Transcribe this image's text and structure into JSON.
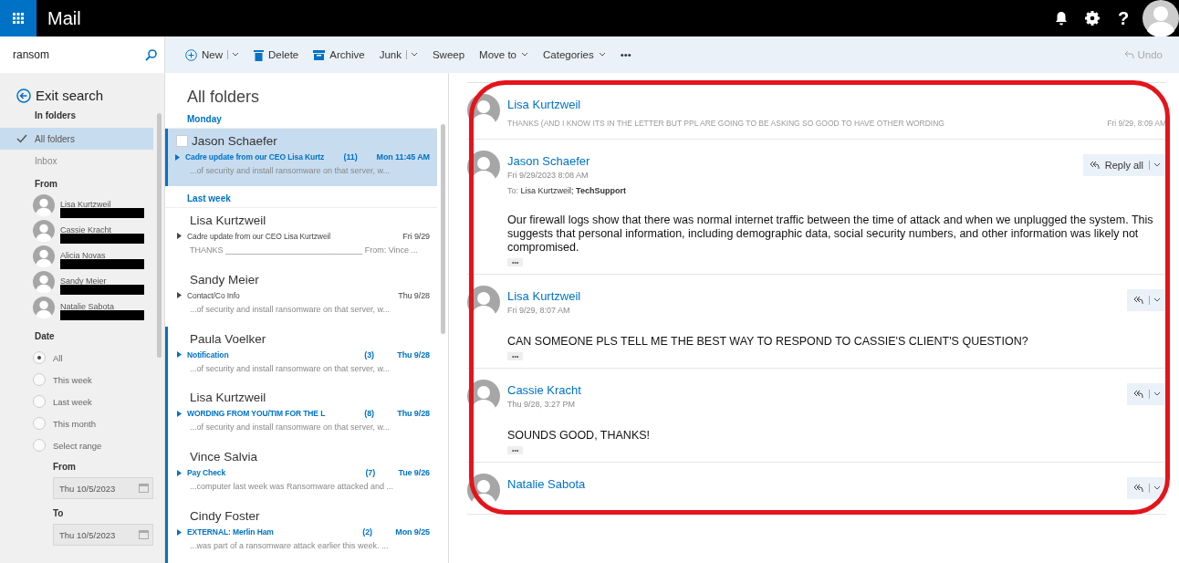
{
  "app": {
    "title": "Mail",
    "help_label": "?"
  },
  "search": {
    "value": "ransom"
  },
  "toolbar": {
    "items": [
      {
        "kind": "new",
        "label": "New",
        "split": true
      },
      {
        "kind": "delete",
        "label": "Delete",
        "split": false
      },
      {
        "kind": "archive",
        "label": "Archive",
        "split": false
      },
      {
        "kind": "junk",
        "label": "Junk",
        "split": true
      },
      {
        "kind": "plain",
        "label": "Sweep",
        "split": false
      },
      {
        "kind": "menu",
        "label": "Move to",
        "split": false
      },
      {
        "kind": "menu",
        "label": "Categories",
        "split": false
      },
      {
        "kind": "more",
        "label": "•••",
        "split": false
      }
    ],
    "undo": {
      "label": "Undo",
      "disabled": true
    }
  },
  "sidebar": {
    "exit_search": "Exit search",
    "in_folders": "In folders",
    "folders": [
      {
        "label": "All folders",
        "selected": true
      },
      {
        "label": "Inbox",
        "selected": false
      }
    ],
    "from_heading": "From",
    "senders": [
      {
        "name": "Lisa Kurtzweil"
      },
      {
        "name": "Cassie Kracht"
      },
      {
        "name": "Alicia Novas"
      },
      {
        "name": "Sandy Meier"
      },
      {
        "name": "Natalie Sabota"
      }
    ],
    "date_heading": "Date",
    "date_options": [
      {
        "label": "All",
        "selected": true
      },
      {
        "label": "This week",
        "selected": false
      },
      {
        "label": "Last week",
        "selected": false
      },
      {
        "label": "This month",
        "selected": false
      },
      {
        "label": "Select range",
        "selected": false
      }
    ],
    "from_label": "From",
    "from_date": "Thu 10/5/2023",
    "to_label": "To",
    "to_date": "Thu 10/5/2023"
  },
  "message_list": {
    "title": "All folders",
    "groups": [
      {
        "heading": "Monday",
        "messages": [
          {
            "sender": "Jason Schaefer",
            "subject": "Cadre update from our CEO Lisa Kurtz",
            "count": "(11)",
            "date": "Mon 11:45 AM",
            "preview": "...of security and install ransomware on that server, w...",
            "unread": true,
            "selected": true
          }
        ]
      },
      {
        "heading": "Last week",
        "messages": [
          {
            "sender": "Lisa Kurtzweil",
            "subject": "Cadre update from our CEO Lisa Kurtzweil",
            "date": "Fri 9/29",
            "preview": "THANKS ______________________________ From: Vince ...",
            "unread": false,
            "selected": false
          },
          {
            "sender": "Sandy Meier",
            "subject": "Contact/Co Info",
            "date": "Thu 9/28",
            "preview": "...of security and install ransomware on that server, w...",
            "unread": false,
            "selected": false
          },
          {
            "sender": "Paula Voelker",
            "subject": "Notification",
            "count": "(3)",
            "date": "Thu 9/28",
            "preview": "...of security and install ransomware on that server, w...",
            "unread": true,
            "selected": false
          },
          {
            "sender": "Lisa Kurtzweil",
            "subject": "WORDING FROM YOU/TIM FOR THE L",
            "count": "(8)",
            "date": "Thu 9/28",
            "preview": "...of security and install ransomware on that server, w...",
            "unread": true,
            "selected": false
          },
          {
            "sender": "Vince Salvia",
            "subject": "Pay Check",
            "count": "(7)",
            "date": "Tue 9/26",
            "preview": "...computer last week was Ransomware attacked and ...",
            "unread": true,
            "selected": false
          },
          {
            "sender": "Cindy Foster",
            "subject": "EXTERNAL: Merlin Ham",
            "count": "(2)",
            "date": "Mon 9/25",
            "preview": "...was part of a ransomware attack earlier this week. ...",
            "unread": true,
            "selected": false
          }
        ]
      }
    ]
  },
  "conversation": {
    "messages": [
      {
        "kind": "collapsed",
        "sender": "Lisa Kurtzweil",
        "snippet": "THANKS (AND I KNOW ITS IN THE LETTER BUT PPL ARE GOING TO BE ASKING SO GOOD TO HAVE OTHER WORDING",
        "date": "Fri 9/29, 8:09 AM"
      },
      {
        "kind": "expanded",
        "sender": "Jason Schaefer",
        "date": "Fri 9/29/2023 8:08 AM",
        "to_label": "To:",
        "to": "Lisa Kurtzweil; **TechSupport**",
        "reply_label": "Reply all",
        "body": "Our firewall logs show that there was normal internet traffic between the time of attack and when we unplugged the system.  This suggests that personal information, including demographic data, social security numbers, and other information was likely not compromised.",
        "more": "•••"
      },
      {
        "kind": "expanded",
        "sender": "Lisa Kurtzweil",
        "date": "Fri 9/29, 8:07 AM",
        "body": "CAN SOMEONE PLS TELL ME THE BEST WAY TO RESPOND TO CASSIE'S CLIENT'S QUESTION?",
        "more": "•••"
      },
      {
        "kind": "expanded",
        "sender": "Cassie Kracht",
        "date": "Thu 9/28, 3:27 PM",
        "body": "SOUNDS GOOD, THANKS!",
        "more": "•••"
      },
      {
        "kind": "partial",
        "sender": "Natalie Sabota"
      }
    ]
  }
}
